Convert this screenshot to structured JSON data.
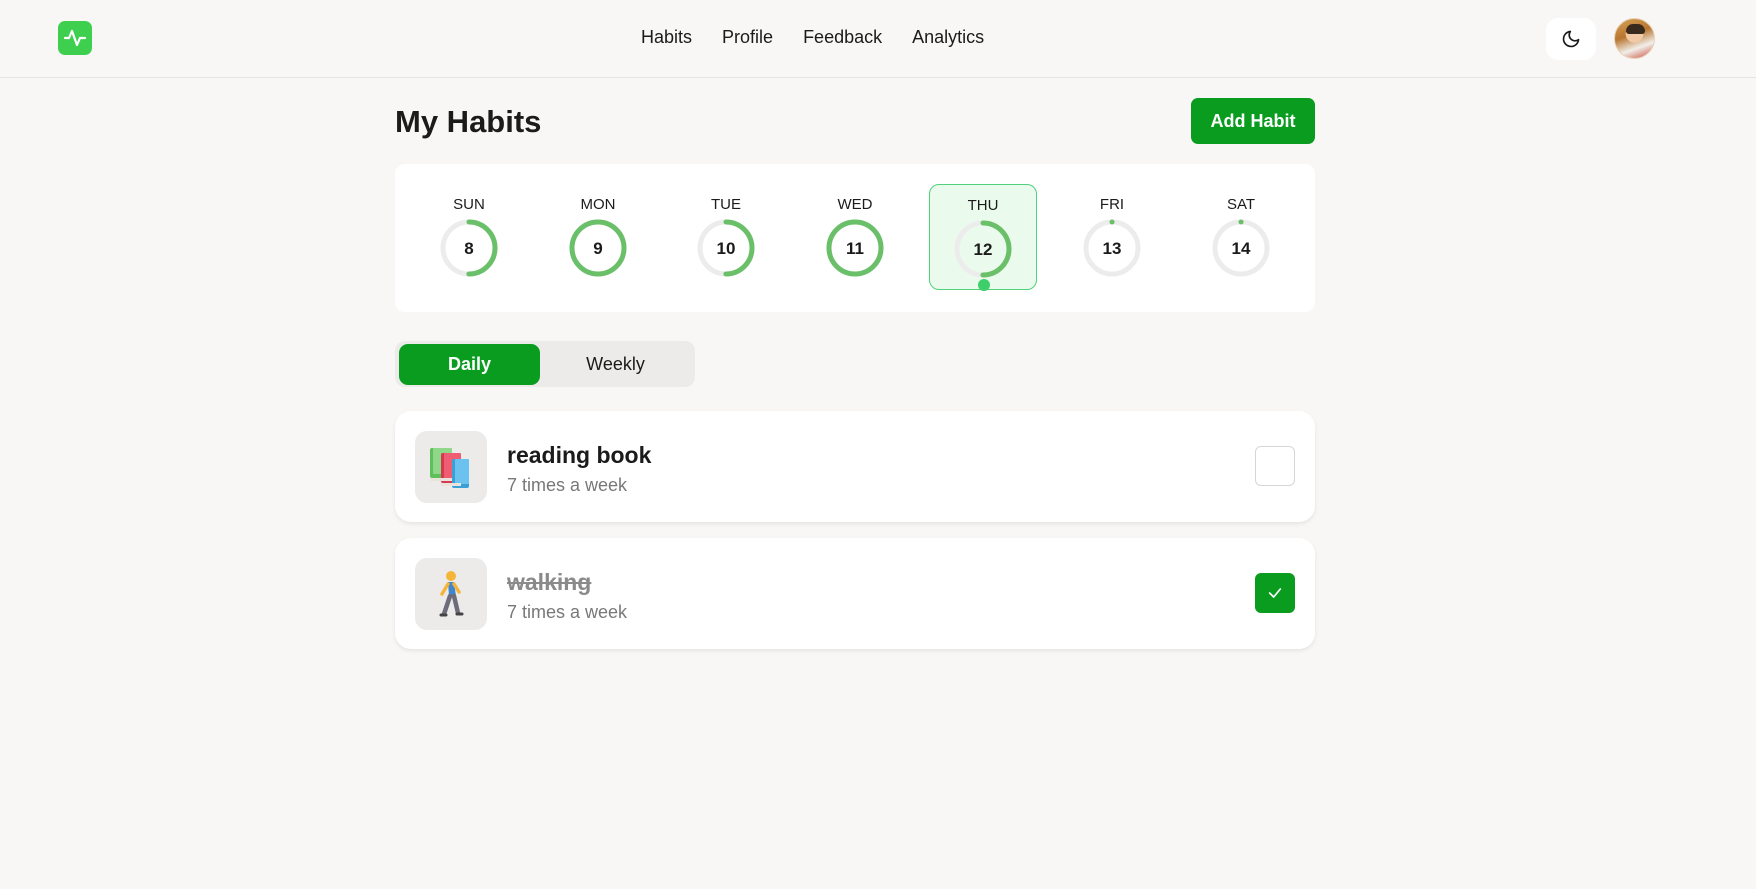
{
  "header": {
    "logo_icon": "activity-pulse-icon",
    "nav": [
      {
        "label": "Habits"
      },
      {
        "label": "Profile"
      },
      {
        "label": "Feedback"
      },
      {
        "label": "Analytics"
      }
    ],
    "theme_icon": "moon-icon",
    "avatar": "user-avatar"
  },
  "page": {
    "title": "My Habits",
    "add_button": "Add Habit"
  },
  "week": {
    "days": [
      {
        "label": "SUN",
        "date": "8",
        "progress": 0.5,
        "active": false
      },
      {
        "label": "MON",
        "date": "9",
        "progress": 1.0,
        "active": false
      },
      {
        "label": "TUE",
        "date": "10",
        "progress": 0.5,
        "active": false
      },
      {
        "label": "WED",
        "date": "11",
        "progress": 1.0,
        "active": false
      },
      {
        "label": "THU",
        "date": "12",
        "progress": 0.5,
        "active": true
      },
      {
        "label": "FRI",
        "date": "13",
        "progress": 0,
        "active": false
      },
      {
        "label": "SAT",
        "date": "14",
        "progress": 0,
        "active": false
      }
    ]
  },
  "tabs": [
    {
      "label": "Daily",
      "selected": true
    },
    {
      "label": "Weekly",
      "selected": false
    }
  ],
  "habits": [
    {
      "name": "reading book",
      "frequency": "7 times a week",
      "icon": "books-icon",
      "completed": false
    },
    {
      "name": "walking",
      "frequency": "7 times a week",
      "icon": "person-walking-icon",
      "completed": true
    }
  ],
  "colors": {
    "accent": "#0a9c1f",
    "ring": "#6abf69",
    "ring_track": "#ececec",
    "logo": "#3fcf4f",
    "background": "#f8f7f5"
  }
}
